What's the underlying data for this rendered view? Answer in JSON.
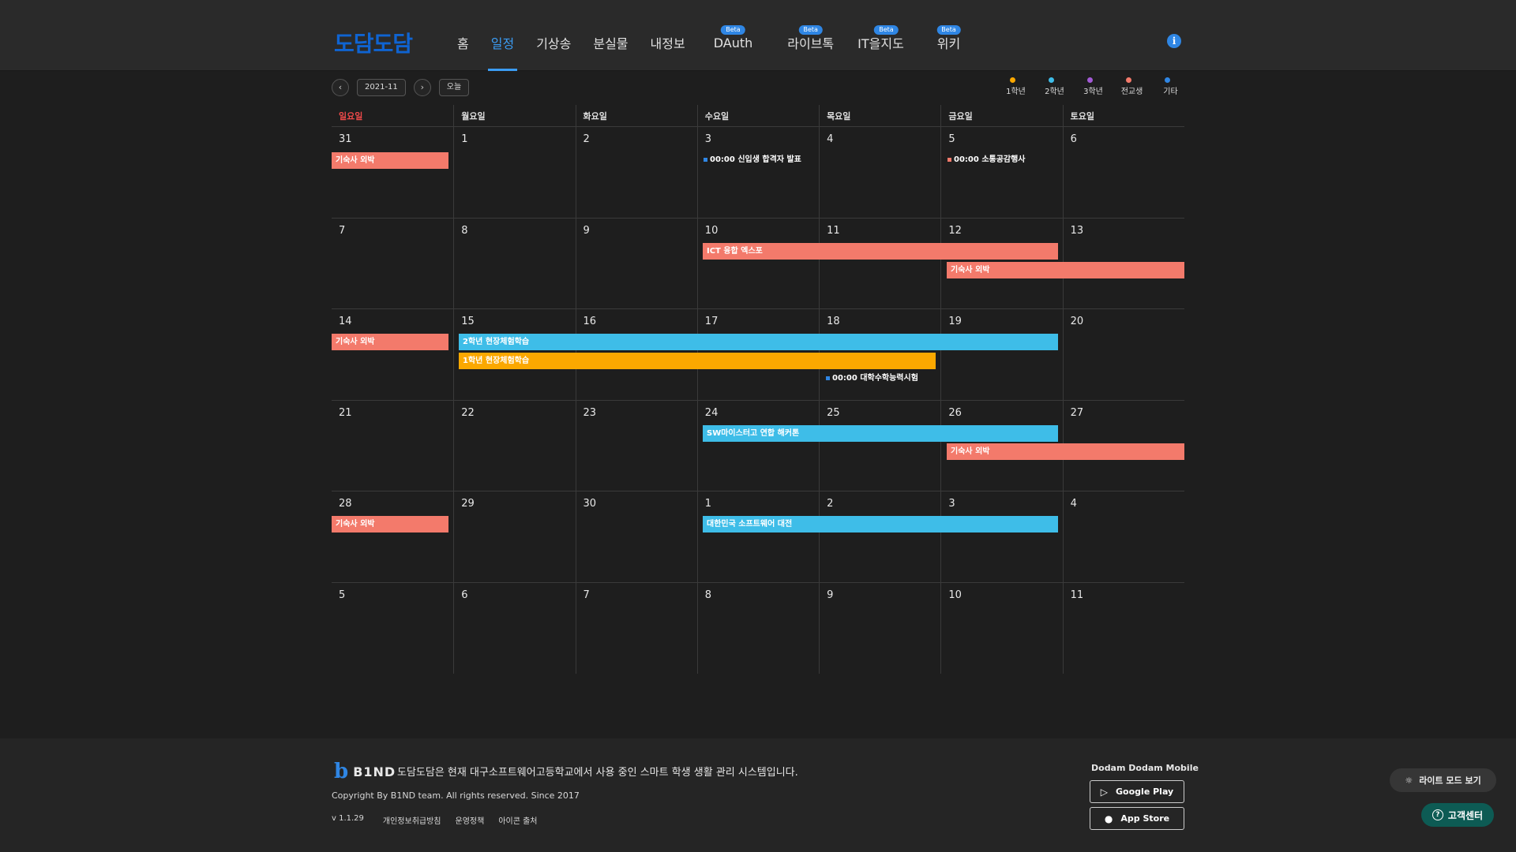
{
  "header": {
    "logo": "도담도담",
    "nav": [
      {
        "label": "홈",
        "beta": ""
      },
      {
        "label": "일정",
        "beta": "",
        "active": true
      },
      {
        "label": "기상송",
        "beta": ""
      },
      {
        "label": "분실물",
        "beta": ""
      },
      {
        "label": "내정보",
        "beta": ""
      },
      {
        "label": "DAuth",
        "beta": "Beta"
      },
      {
        "label": "라이브톡",
        "beta": "Beta"
      },
      {
        "label": "IT을지도",
        "beta": "Beta"
      },
      {
        "label": "위키",
        "beta": "Beta"
      }
    ],
    "info_icon": "i"
  },
  "toolbar": {
    "prev": "‹",
    "month": "2021-11",
    "next": "›",
    "today": "오늘"
  },
  "legend": [
    {
      "label": "1학년",
      "color": "#fba800"
    },
    {
      "label": "2학년",
      "color": "#3ebde8"
    },
    {
      "label": "3학년",
      "color": "#a35ad6"
    },
    {
      "label": "전교생",
      "color": "#f37a6b"
    },
    {
      "label": "기타",
      "color": "#2f86e4"
    }
  ],
  "calendar": {
    "weekdays": [
      "일요일",
      "월요일",
      "화요일",
      "수요일",
      "목요일",
      "금요일",
      "토요일"
    ],
    "weeks": [
      [
        "31",
        "1",
        "2",
        "3",
        "4",
        "5",
        "6"
      ],
      [
        "7",
        "8",
        "9",
        "10",
        "11",
        "12",
        "13"
      ],
      [
        "14",
        "15",
        "16",
        "17",
        "18",
        "19",
        "20"
      ],
      [
        "21",
        "22",
        "23",
        "24",
        "25",
        "26",
        "27"
      ],
      [
        "28",
        "29",
        "30",
        "1",
        "2",
        "3",
        "4"
      ],
      [
        "5",
        "6",
        "7",
        "8",
        "9",
        "10",
        "11"
      ]
    ],
    "events": {
      "w0_dorm": "기숙사 외박",
      "w0_admission": "00:00 신입생 합격자 발표",
      "w0_sotong": "00:00 소통공감행사",
      "w1_ict": "ICT 융합 엑스포",
      "w1_dorm": "기숙사 외박",
      "w2_dorm": "기숙사 외박",
      "w2_g2": "2학년 현장체험학습",
      "w2_g1": "1학년 현장체험학습",
      "w2_csat": "00:00 대학수학능력시험",
      "w3_sw": "SW마이스터고 연합 해커톤",
      "w3_dorm": "기숙사 외박",
      "w4_dorm": "기숙사 외박",
      "w4_contest": "대한민국 소프트웨어 대전"
    }
  },
  "footer": {
    "brand": "B1ND",
    "description": "도담도담은 현재 대구소프트웨어고등학교에서 사용 중인 스마트 학생 생활 관리 시스템입니다.",
    "copyright": "Copyright By B1ND team. All rights reserved. Since 2017",
    "version": "v 1.1.29",
    "links": [
      "개인정보취급방침",
      "운영정책",
      "아이콘 출처"
    ],
    "mobile_title": "Dodam Dodam Mobile",
    "google_play": "Google Play",
    "app_store": "App Store"
  },
  "floating": {
    "light_mode": "라이트 모드 보기",
    "help": "고객센터"
  }
}
